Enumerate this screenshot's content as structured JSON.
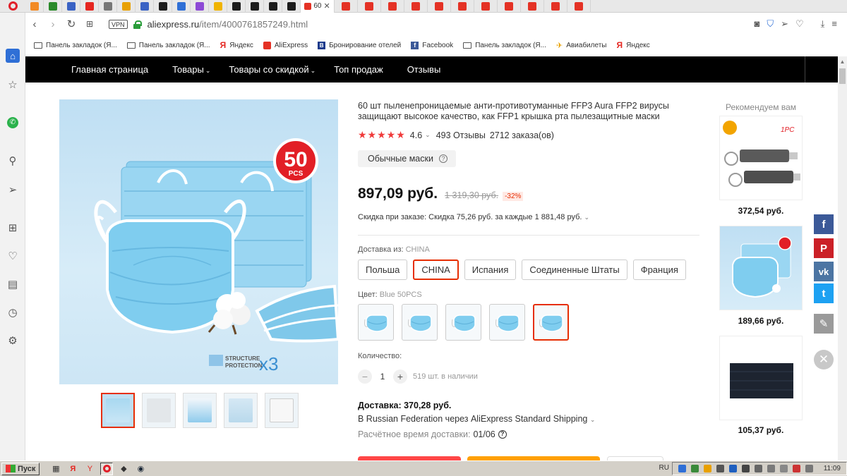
{
  "browser": {
    "active_tab_label": "60",
    "url_host": "aliexpress.ru",
    "url_path": "/item/4000761857249.html",
    "vpn_label": "VPN",
    "tab_icon_colors": [
      "#f28a25",
      "#2a8a2a",
      "#3a62c4",
      "#e52620",
      "#777777",
      "#e8a000",
      "#3a62c4",
      "#1c1c1c",
      "#2f6fd6",
      "#8d4ad6",
      "#f0b400",
      "#1c1c1c",
      "#1c1c1c",
      "#1c1c1c",
      "#1c1c1c",
      "#e43225",
      "#e43225",
      "#e43225",
      "#e43225",
      "#e43225",
      "#e43225",
      "#e43225",
      "#e43225",
      "#e43225",
      "#e43225",
      "#e43225"
    ]
  },
  "bookmarks": [
    {
      "label": "Панель закладок (Я...",
      "icon": "folder-icon"
    },
    {
      "label": "Панель закладок (Я...",
      "icon": "folder-icon"
    },
    {
      "label": "Яндекс",
      "icon": "yandex-icon"
    },
    {
      "label": "AliExpress",
      "icon": "aliexpress-icon"
    },
    {
      "label": "Бронирование отелей",
      "icon": "booking-icon"
    },
    {
      "label": "Facebook",
      "icon": "facebook-icon"
    },
    {
      "label": "Панель закладок (Я...",
      "icon": "folder-icon"
    },
    {
      "label": "Авиабилеты",
      "icon": "plane-icon"
    },
    {
      "label": "Яндекс",
      "icon": "yandex-icon"
    }
  ],
  "site_nav": {
    "home": "Главная страница",
    "products": "Товары",
    "discounted": "Товары со скидкой",
    "top_sales": "Топ продаж",
    "reviews": "Отзывы"
  },
  "product": {
    "title": "60 шт пыленепроницаемые анти-противотуманные FFP3 Aura FFP2 вирусы защищают высокое качество, как FFP1 крышка рта пылезащитные маски",
    "stars": "★★★★★",
    "rating": "4.6",
    "reviews": "493 Отзывы",
    "orders": "2712 заказа(ов)",
    "variant_chip": "Обычные маски",
    "price": "897,09 руб.",
    "old_price": "1 319,30 руб.",
    "discount": "-32%",
    "bulk_discount": "Скидка при заказе: Скидка 75,26 руб. за каждые 1 881,48 руб.",
    "ship_from_label": "Доставка из:",
    "ship_from_value": "CHINA",
    "ship_from_options": [
      "Польша",
      "CHINA",
      "Испания",
      "Соединенные Штаты",
      "Франция"
    ],
    "ship_from_selected": 1,
    "color_label": "Цвет:",
    "color_value": "Blue 50PCS",
    "color_count": 5,
    "color_selected": 4,
    "qty_label": "Количество:",
    "qty_value": "1",
    "stock": "519 шт. в наличии",
    "delivery": "Доставка: 370,28 руб.",
    "delivery_via": "В Russian Federation через AliExpress Standard Shipping",
    "eta_label": "Расчётное время доставки:",
    "eta_value": "01/06",
    "image_badge_number": "50",
    "image_badge_unit": "PCS",
    "image_caption_1": "STRUCTURE",
    "image_caption_2": "PROTECTION",
    "image_caption_x": "x3"
  },
  "recommendations": {
    "title": "Рекомендуем вам",
    "items": [
      {
        "price": "372,54 руб.",
        "tag": "1PC"
      },
      {
        "price": "189,66 руб."
      },
      {
        "price": "105,37 руб."
      }
    ]
  },
  "share": [
    {
      "name": "facebook",
      "glyph": "f",
      "color": "#3b5998"
    },
    {
      "name": "pinterest",
      "glyph": "P",
      "color": "#cb2027"
    },
    {
      "name": "vk",
      "glyph": "vk",
      "color": "#4c75a3"
    },
    {
      "name": "twitter",
      "glyph": "t",
      "color": "#1da1f2"
    },
    {
      "name": "edit",
      "glyph": "✎",
      "color": "#9a9a9a"
    }
  ],
  "taskbar": {
    "start_label": "Пуск",
    "lang": "RU",
    "time": "11:09"
  }
}
